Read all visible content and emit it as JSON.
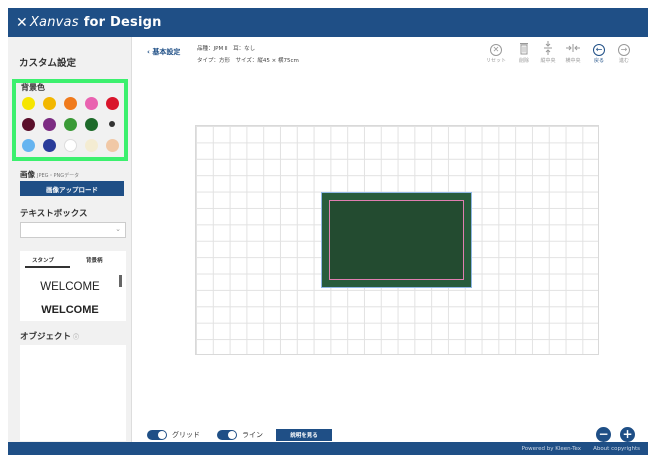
{
  "app": {
    "logo_prefix": "Xanvas",
    "logo_suffix": "for Design",
    "logo_icon": "x-logo-icon"
  },
  "sidebar": {
    "title": "カスタム設定",
    "bg_color_label": "背景色",
    "palette": [
      [
        "#f6e500",
        "#f2b700",
        "#f07a1c",
        "#e962b0",
        "#d9152b"
      ],
      [
        "#5a0f2a",
        "#7c2c82",
        "#3a9a36",
        "#1d6a2a",
        "#333333"
      ],
      [
        "#66b4f0",
        "#2a3c9a",
        "#ffffff",
        "#f4ecd2",
        "#f1c8a6"
      ]
    ],
    "image_label": "画像",
    "image_sub": "JPEG・PNGデータ",
    "upload_button": "画像アップロード",
    "textbox_label": "テキストボックス",
    "stamp_tabs": [
      "スタンプ",
      "背景柄"
    ],
    "stamp_items": [
      "WELCOME",
      "WELCOME"
    ],
    "object_label": "オブジェクト",
    "object_info_icon": "ⓘ"
  },
  "header": {
    "back_label": "‹ 基本設定",
    "product_line1": "品種：JPM Ⅱ　耳：なし",
    "product_line2": "タイプ：方形　サイズ：縦45 × 横75cm",
    "tools": [
      {
        "icon": "reset-icon",
        "glyph": "✕",
        "label": "リセット"
      },
      {
        "icon": "trash-icon",
        "glyph": "🗑",
        "label": "削除"
      },
      {
        "icon": "vertical-center-icon",
        "glyph": "⇵",
        "label": "縦中央"
      },
      {
        "icon": "horizontal-center-icon",
        "glyph": "⇄",
        "label": "横中央"
      },
      {
        "icon": "undo-icon",
        "glyph": "←",
        "label": "戻る"
      },
      {
        "icon": "redo-icon",
        "glyph": "→",
        "label": "進む"
      }
    ]
  },
  "bottom": {
    "grid_label": "グリッド",
    "line_label": "ライン",
    "explain_button": "説明を見る",
    "zoom_out": "−",
    "zoom_in": "+"
  },
  "footer": {
    "powered": "Powered by Kleen-Tex",
    "copyright": "About copyrights"
  },
  "colors": {
    "brand": "#1f4f86",
    "rug": "#285c3c",
    "rug_border": "#e07eb0",
    "highlight": "#3cf06e"
  }
}
